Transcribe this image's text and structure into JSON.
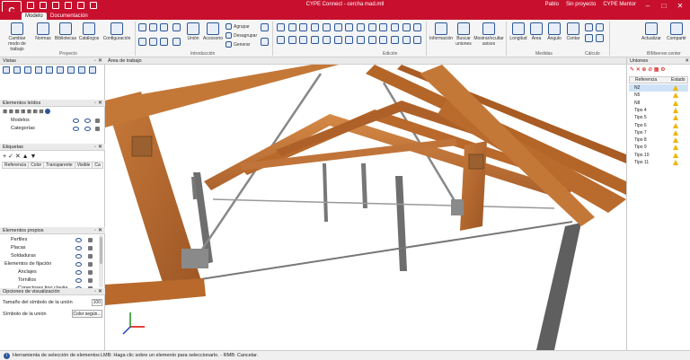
{
  "window": {
    "title": "CYPE Connect - cercha mad.mtl",
    "user": "Pablo",
    "project_status": "Sin proyecto",
    "mentor": "CYPE Mentor",
    "logo_text": "C"
  },
  "tabs": [
    {
      "label": "Modelo",
      "active": true
    },
    {
      "label": "Documentación",
      "active": false
    }
  ],
  "ribbon": {
    "proyecto": {
      "label": "Proyecto",
      "buttons": [
        "Cambiar modo de trabajo",
        "Normas",
        "Bibliotecas",
        "Catálogos",
        "Configuración"
      ]
    },
    "introduccion": {
      "label": "Introducción",
      "buttons": [
        "Unión",
        "Accesorio"
      ],
      "small": [
        "Agrupar",
        "Desagrupar",
        "Generar"
      ]
    },
    "edicion": {
      "label": "Edición"
    },
    "info": {
      "buttons": [
        "Información",
        "Buscar uniones",
        "Mostrar/ocultar avisos"
      ]
    },
    "medidas": {
      "label": "Medidas",
      "buttons": [
        "Longitud",
        "Área",
        "Ángulo"
      ]
    },
    "calculo": {
      "label": "Cálculo",
      "buttons": [
        "Contar"
      ]
    },
    "bim": {
      "label": "BIMserver.center",
      "buttons": [
        "Actualizar",
        "Compartir"
      ]
    }
  },
  "panels": {
    "vistas": {
      "title": "Vistas"
    },
    "elementos_leidos": {
      "title": "Elementos leídos",
      "items": [
        "Modelos",
        "Categorías"
      ]
    },
    "etiquetas": {
      "title": "Etiquetas",
      "columns": [
        "Referencia",
        "Color",
        "Transparente",
        "Visible",
        "Ca"
      ]
    },
    "elementos_propios": {
      "title": "Elementos propios",
      "items": [
        "Perfiles",
        "Placas",
        "Soldaduras",
        "Elementos de fijación",
        "Anclajes",
        "Tornillos",
        "Conectores tipo clavija"
      ]
    },
    "opciones": {
      "title": "Opciones de visualización",
      "size_label": "Tamaño del símbolo de la unión",
      "size_value": "100",
      "symbol_label": "Símbolo de la unión",
      "symbol_button": "Color según..."
    }
  },
  "viewport": {
    "title": "Área de trabajo"
  },
  "uniones": {
    "title": "Uniones",
    "columns": [
      "Referencia",
      "Estado"
    ],
    "rows": [
      {
        "ref": "N2",
        "selected": true
      },
      {
        "ref": "N5",
        "selected": false
      },
      {
        "ref": "N8",
        "selected": false
      },
      {
        "ref": "Tipo 4",
        "selected": false
      },
      {
        "ref": "Tipo 5",
        "selected": false
      },
      {
        "ref": "Tipo 6",
        "selected": false
      },
      {
        "ref": "Tipo 7",
        "selected": false
      },
      {
        "ref": "Tipo 8",
        "selected": false
      },
      {
        "ref": "Tipo 9",
        "selected": false
      },
      {
        "ref": "Tipo 10",
        "selected": false
      },
      {
        "ref": "Tipo 11",
        "selected": false
      }
    ]
  },
  "status": {
    "tool": "Herramienta de selección de elementos",
    "hint": "LMB: Haga clic sobre un elemento para seleccionarlo. - RMB: Cancelar."
  },
  "colors": {
    "brand": "#c8102e",
    "timber": "#b8692b",
    "steel": "#6e6e6e",
    "warning": "#f0b400"
  }
}
